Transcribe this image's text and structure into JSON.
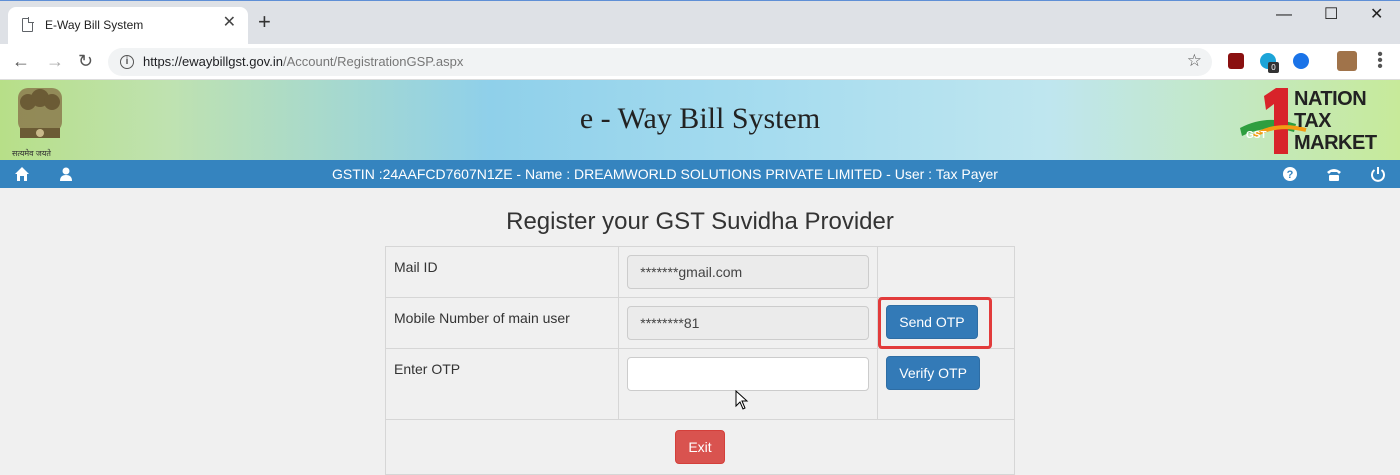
{
  "browser": {
    "tab_title": "E-Way Bill System",
    "url_host": "https://ewaybillgst.gov.in",
    "url_path": "/Account/RegistrationGSP.aspx",
    "extension_badge": "0"
  },
  "header": {
    "site_title": "e - Way Bill System",
    "emblem_caption": "सत्यमेव जयते",
    "logo_lines": [
      "NATION",
      "TAX",
      "MARKET"
    ],
    "logo_gst": "GST",
    "logo_digit": "1"
  },
  "navbar": {
    "gst_info": "GSTIN :24AAFCD7607N1ZE - Name : DREAMWORLD SOLUTIONS PRIVATE LIMITED - User : Tax Payer",
    "color": "#3584bf"
  },
  "main": {
    "heading": "Register your GST Suvidha Provider",
    "rows": [
      {
        "label": "Mail ID",
        "value": "*******gmail.com"
      },
      {
        "label": "Mobile Number of main user",
        "value": "********81",
        "action": "Send OTP"
      },
      {
        "label": "Enter OTP",
        "value": "",
        "action": "Verify OTP"
      }
    ],
    "exit_label": "Exit"
  },
  "colors": {
    "primary": "#337ab7",
    "danger": "#d9534f",
    "highlight": "#e23b3b"
  }
}
